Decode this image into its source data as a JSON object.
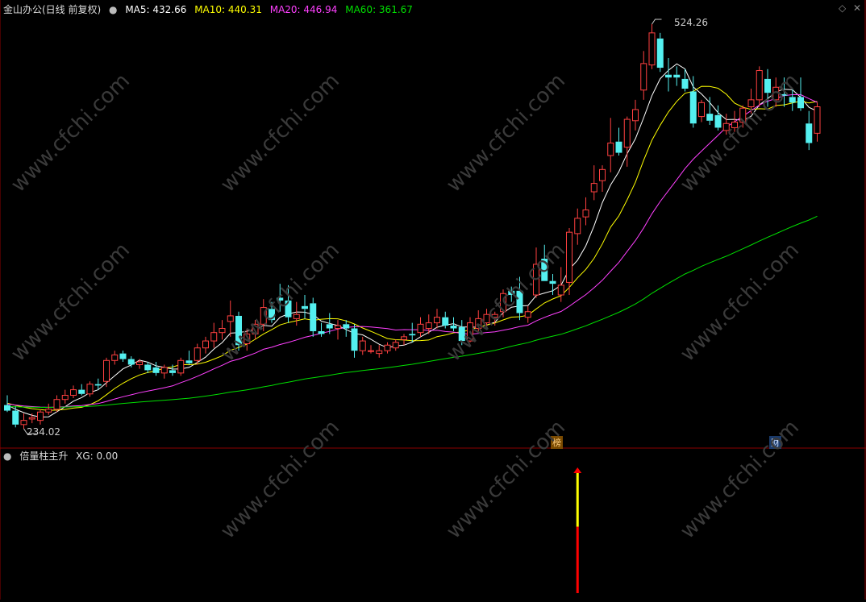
{
  "main_panel": {
    "title": "金山办公(日线 前复权)",
    "indicators": [
      {
        "label": "MA5: 432.66",
        "color": "#ffffff"
      },
      {
        "label": "MA10: 440.31",
        "color": "#ffff00"
      },
      {
        "label": "MA20: 446.94",
        "color": "#ff40ff"
      },
      {
        "label": "MA60: 361.67",
        "color": "#00e000"
      }
    ],
    "max_label": "524.26",
    "min_label": "234.02",
    "badges": {
      "bang": "榜",
      "cai": "财"
    }
  },
  "sub_panel": {
    "title": "倍量柱主升",
    "xg_label": "XG: 0.00"
  },
  "watermark": "www.cfchi.com",
  "colors": {
    "up": "#ff4040",
    "down": "#54f0f0",
    "ma5": "#ffffff",
    "ma10": "#ffff00",
    "ma20": "#ff40ff",
    "ma60": "#00e000",
    "signal_top": "#ffff00",
    "signal_bottom": "#ff0000"
  },
  "chart_data": {
    "type": "candlestick",
    "ylim": [
      234.02,
      524.26
    ],
    "high": 524.26,
    "low": 234.02,
    "candles": [
      {
        "o": 251,
        "h": 258,
        "l": 246,
        "c": 247
      },
      {
        "o": 247,
        "h": 250,
        "l": 235,
        "c": 237
      },
      {
        "o": 237,
        "h": 245,
        "l": 234,
        "c": 240
      },
      {
        "o": 241,
        "h": 245,
        "l": 238,
        "c": 242
      },
      {
        "o": 240,
        "h": 248,
        "l": 237,
        "c": 246
      },
      {
        "o": 246,
        "h": 252,
        "l": 244,
        "c": 248
      },
      {
        "o": 248,
        "h": 258,
        "l": 246,
        "c": 255
      },
      {
        "o": 255,
        "h": 262,
        "l": 252,
        "c": 258
      },
      {
        "o": 258,
        "h": 265,
        "l": 256,
        "c": 262
      },
      {
        "o": 262,
        "h": 266,
        "l": 258,
        "c": 259
      },
      {
        "o": 259,
        "h": 268,
        "l": 257,
        "c": 266
      },
      {
        "o": 266,
        "h": 270,
        "l": 262,
        "c": 265
      },
      {
        "o": 268,
        "h": 285,
        "l": 264,
        "c": 283
      },
      {
        "o": 283,
        "h": 290,
        "l": 280,
        "c": 287
      },
      {
        "o": 288,
        "h": 290,
        "l": 282,
        "c": 284
      },
      {
        "o": 284,
        "h": 286,
        "l": 278,
        "c": 280
      },
      {
        "o": 280,
        "h": 284,
        "l": 277,
        "c": 282
      },
      {
        "o": 280,
        "h": 282,
        "l": 274,
        "c": 276
      },
      {
        "o": 278,
        "h": 282,
        "l": 272,
        "c": 274
      },
      {
        "o": 274,
        "h": 280,
        "l": 270,
        "c": 278
      },
      {
        "o": 276,
        "h": 280,
        "l": 272,
        "c": 274
      },
      {
        "o": 274,
        "h": 285,
        "l": 272,
        "c": 283
      },
      {
        "o": 283,
        "h": 290,
        "l": 280,
        "c": 281
      },
      {
        "o": 283,
        "h": 295,
        "l": 280,
        "c": 292
      },
      {
        "o": 292,
        "h": 300,
        "l": 288,
        "c": 297
      },
      {
        "o": 297,
        "h": 310,
        "l": 292,
        "c": 303
      },
      {
        "o": 303,
        "h": 312,
        "l": 298,
        "c": 306
      },
      {
        "o": 311,
        "h": 326,
        "l": 300,
        "c": 315
      },
      {
        "o": 315,
        "h": 318,
        "l": 290,
        "c": 294
      },
      {
        "o": 295,
        "h": 305,
        "l": 290,
        "c": 302
      },
      {
        "o": 302,
        "h": 312,
        "l": 298,
        "c": 309
      },
      {
        "o": 309,
        "h": 327,
        "l": 304,
        "c": 321
      },
      {
        "o": 320,
        "h": 325,
        "l": 310,
        "c": 312
      },
      {
        "o": 328,
        "h": 338,
        "l": 318,
        "c": 326
      },
      {
        "o": 326,
        "h": 337,
        "l": 310,
        "c": 314
      },
      {
        "o": 313,
        "h": 325,
        "l": 308,
        "c": 316
      },
      {
        "o": 322,
        "h": 330,
        "l": 313,
        "c": 320
      },
      {
        "o": 324,
        "h": 328,
        "l": 300,
        "c": 304
      },
      {
        "o": 304,
        "h": 310,
        "l": 300,
        "c": 302
      },
      {
        "o": 309,
        "h": 317,
        "l": 302,
        "c": 306
      },
      {
        "o": 306,
        "h": 312,
        "l": 298,
        "c": 308
      },
      {
        "o": 309,
        "h": 312,
        "l": 300,
        "c": 306
      },
      {
        "o": 306,
        "h": 309,
        "l": 285,
        "c": 290
      },
      {
        "o": 290,
        "h": 300,
        "l": 287,
        "c": 297
      },
      {
        "o": 290,
        "h": 294,
        "l": 288,
        "c": 290
      },
      {
        "o": 288,
        "h": 294,
        "l": 285,
        "c": 290
      },
      {
        "o": 290,
        "h": 296,
        "l": 288,
        "c": 294
      },
      {
        "o": 292,
        "h": 298,
        "l": 290,
        "c": 296
      },
      {
        "o": 298,
        "h": 302,
        "l": 294,
        "c": 300
      },
      {
        "o": 302,
        "h": 310,
        "l": 296,
        "c": 301
      },
      {
        "o": 303,
        "h": 314,
        "l": 300,
        "c": 309
      },
      {
        "o": 306,
        "h": 316,
        "l": 302,
        "c": 310
      },
      {
        "o": 310,
        "h": 320,
        "l": 306,
        "c": 314
      },
      {
        "o": 314,
        "h": 318,
        "l": 306,
        "c": 308
      },
      {
        "o": 308,
        "h": 314,
        "l": 304,
        "c": 306
      },
      {
        "o": 307,
        "h": 312,
        "l": 294,
        "c": 297
      },
      {
        "o": 297,
        "h": 314,
        "l": 296,
        "c": 310
      },
      {
        "o": 306,
        "h": 319,
        "l": 304,
        "c": 313
      },
      {
        "o": 310,
        "h": 320,
        "l": 305,
        "c": 316
      },
      {
        "o": 314,
        "h": 318,
        "l": 308,
        "c": 316
      },
      {
        "o": 318,
        "h": 334,
        "l": 314,
        "c": 331
      },
      {
        "o": 333,
        "h": 336,
        "l": 325,
        "c": 330
      },
      {
        "o": 333,
        "h": 343,
        "l": 312,
        "c": 317
      },
      {
        "o": 314,
        "h": 322,
        "l": 310,
        "c": 318
      },
      {
        "o": 330,
        "h": 364,
        "l": 328,
        "c": 352
      },
      {
        "o": 356,
        "h": 366,
        "l": 340,
        "c": 340
      },
      {
        "o": 340,
        "h": 345,
        "l": 330,
        "c": 338
      },
      {
        "o": 330,
        "h": 350,
        "l": 325,
        "c": 337
      },
      {
        "o": 339,
        "h": 378,
        "l": 330,
        "c": 375
      },
      {
        "o": 374,
        "h": 392,
        "l": 366,
        "c": 385
      },
      {
        "o": 386,
        "h": 400,
        "l": 380,
        "c": 391
      },
      {
        "o": 404,
        "h": 423,
        "l": 398,
        "c": 410
      },
      {
        "o": 412,
        "h": 423,
        "l": 404,
        "c": 420
      },
      {
        "o": 430,
        "h": 457,
        "l": 418,
        "c": 439
      },
      {
        "o": 440,
        "h": 450,
        "l": 430,
        "c": 432
      },
      {
        "o": 436,
        "h": 458,
        "l": 422,
        "c": 456
      },
      {
        "o": 455,
        "h": 470,
        "l": 448,
        "c": 463
      },
      {
        "o": 477,
        "h": 505,
        "l": 470,
        "c": 496
      },
      {
        "o": 495,
        "h": 524.26,
        "l": 492,
        "c": 518
      },
      {
        "o": 514,
        "h": 518,
        "l": 490,
        "c": 493
      },
      {
        "o": 488,
        "h": 500,
        "l": 476,
        "c": 486
      },
      {
        "o": 488,
        "h": 494,
        "l": 480,
        "c": 486
      },
      {
        "o": 485,
        "h": 492,
        "l": 476,
        "c": 478
      },
      {
        "o": 476,
        "h": 487,
        "l": 450,
        "c": 453
      },
      {
        "o": 458,
        "h": 470,
        "l": 454,
        "c": 468
      },
      {
        "o": 460,
        "h": 472,
        "l": 452,
        "c": 455
      },
      {
        "o": 459,
        "h": 466,
        "l": 448,
        "c": 450
      },
      {
        "o": 448,
        "h": 460,
        "l": 445,
        "c": 453
      },
      {
        "o": 450,
        "h": 462,
        "l": 447,
        "c": 454
      },
      {
        "o": 454,
        "h": 466,
        "l": 450,
        "c": 464
      },
      {
        "o": 465,
        "h": 478,
        "l": 460,
        "c": 470
      },
      {
        "o": 470,
        "h": 494,
        "l": 465,
        "c": 491
      },
      {
        "o": 485,
        "h": 492,
        "l": 465,
        "c": 475
      },
      {
        "o": 470,
        "h": 486,
        "l": 465,
        "c": 479
      },
      {
        "o": 474,
        "h": 486,
        "l": 465,
        "c": 473
      },
      {
        "o": 472,
        "h": 478,
        "l": 462,
        "c": 468
      },
      {
        "o": 472,
        "h": 486,
        "l": 462,
        "c": 464
      },
      {
        "o": 453,
        "h": 462,
        "l": 434,
        "c": 439
      },
      {
        "o": 446,
        "h": 468,
        "l": 440,
        "c": 465
      }
    ],
    "signal": {
      "index": 69,
      "yellow": [
        0.55,
        1.0
      ],
      "red": [
        0.0,
        0.55
      ]
    }
  }
}
